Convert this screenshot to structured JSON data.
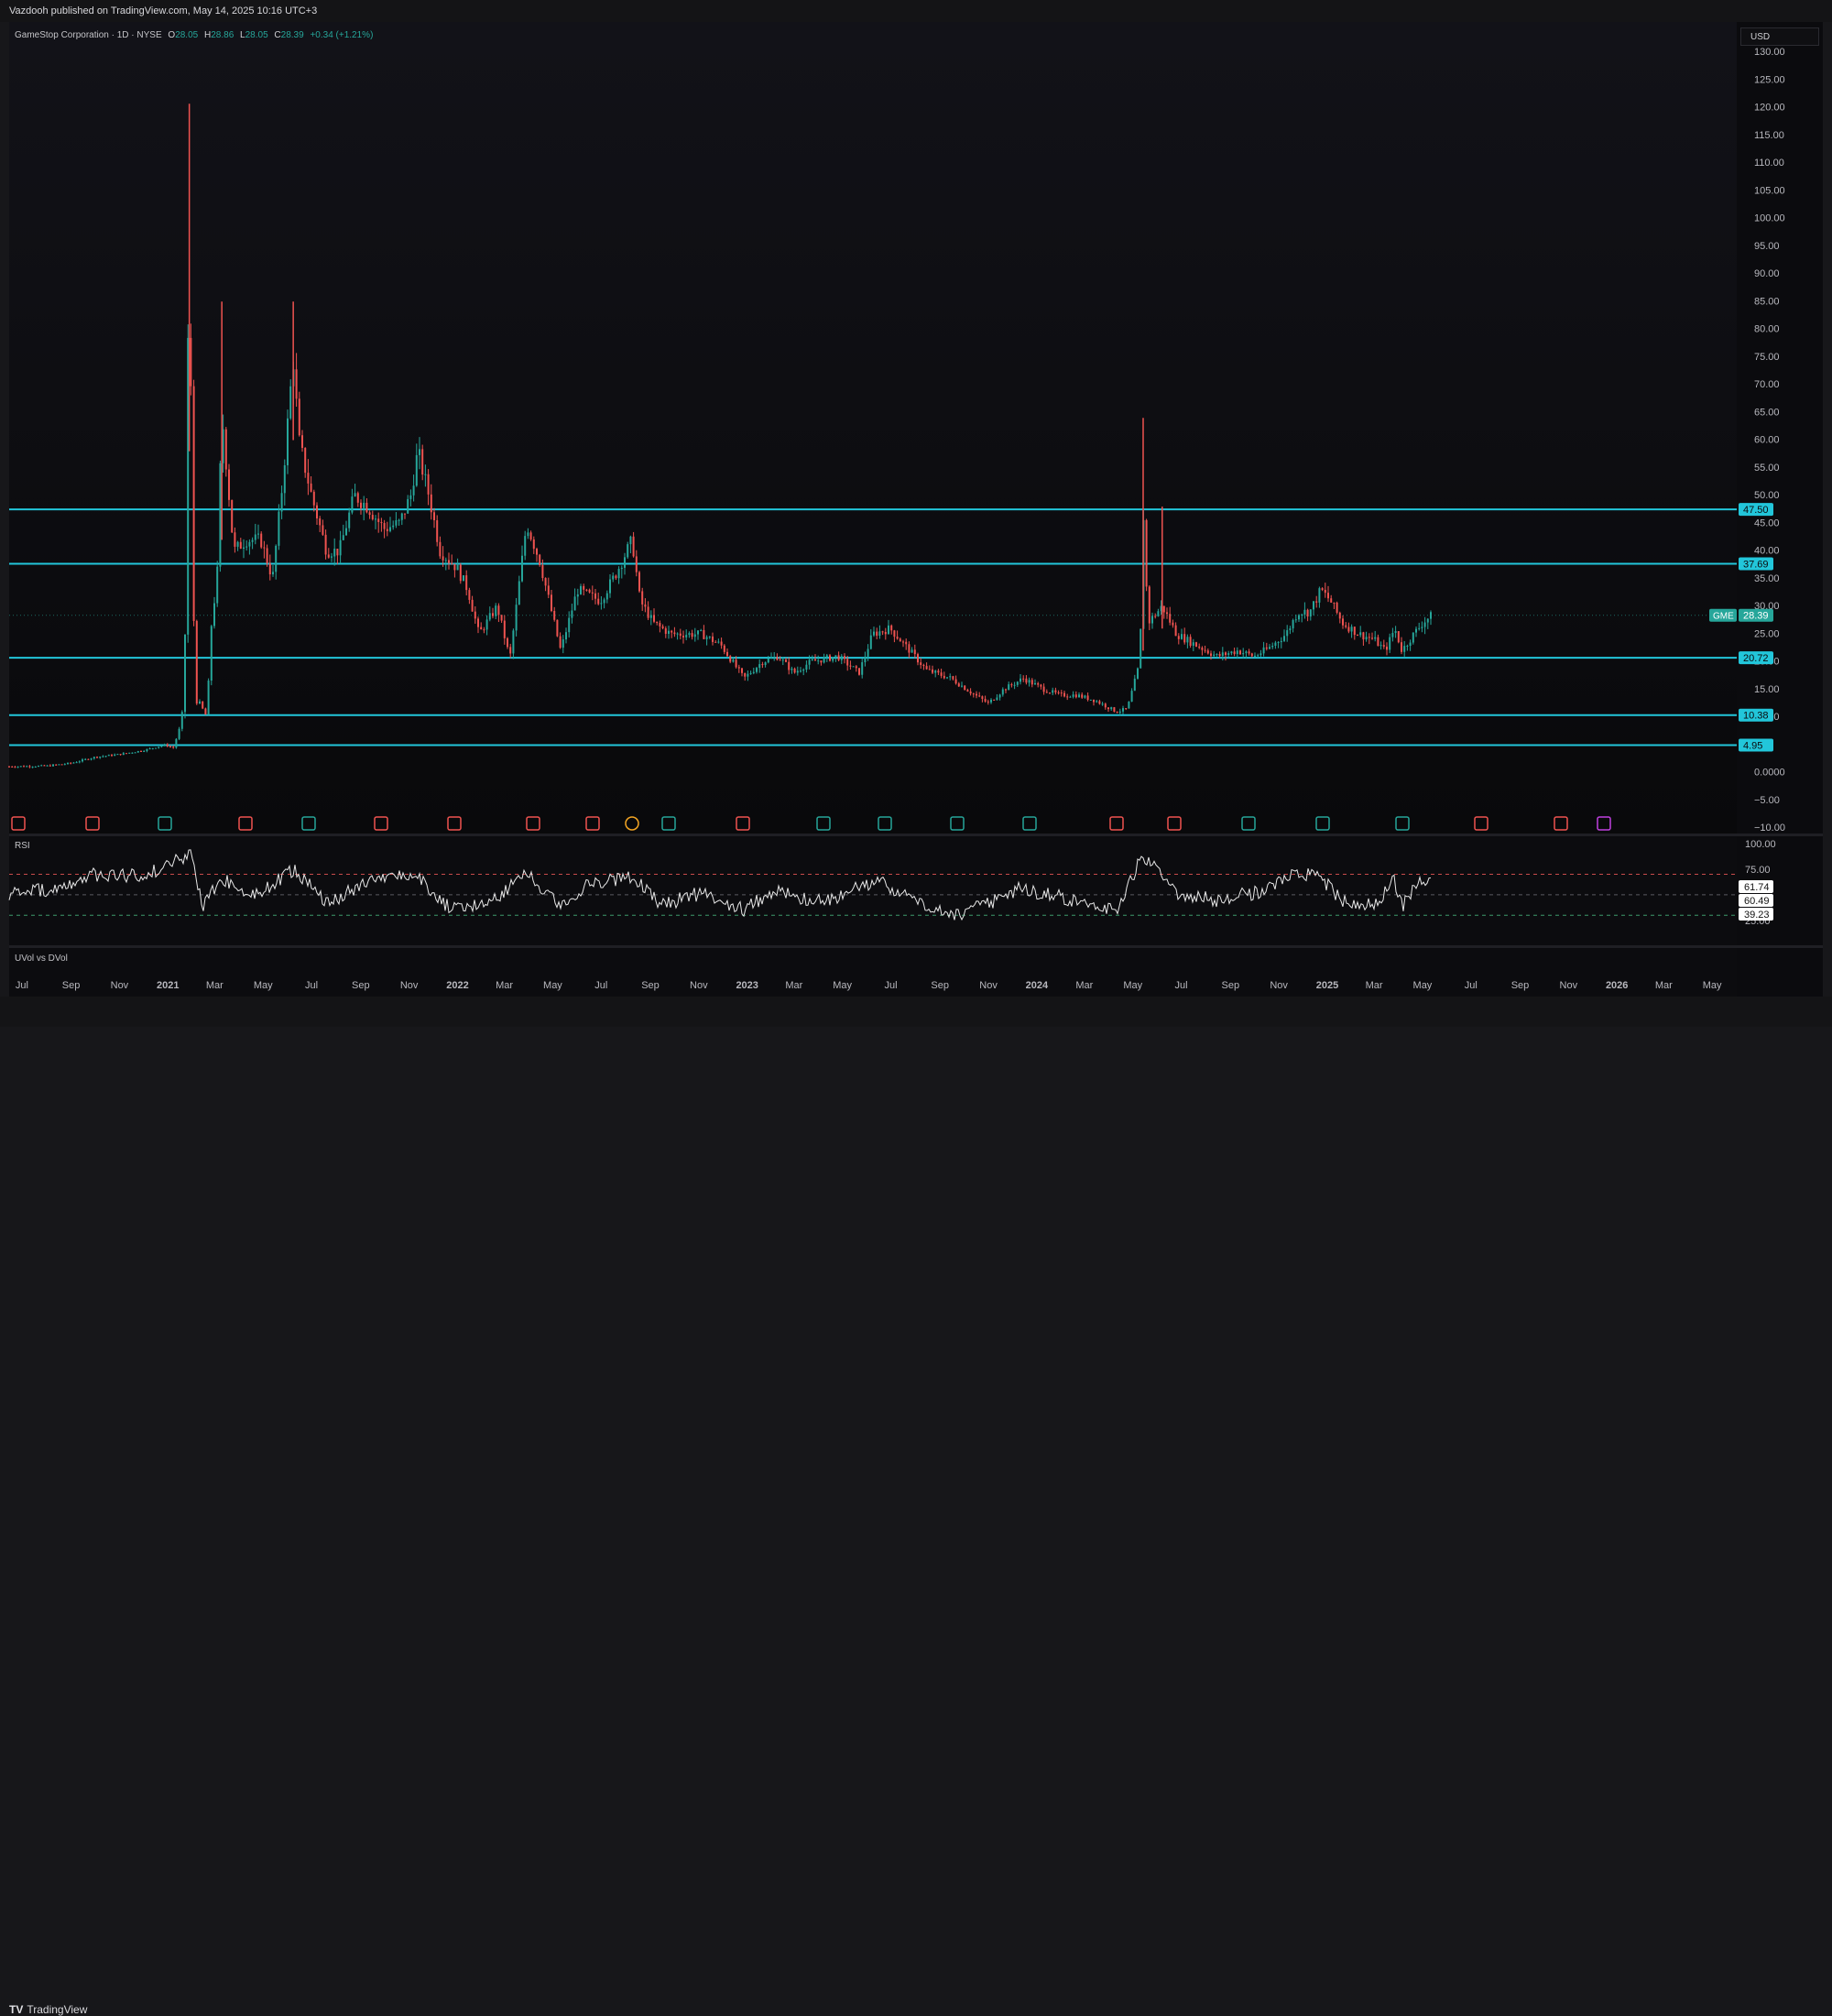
{
  "header": {
    "published": "Vazdooh published on TradingView.com, May 14, 2025 10:16 UTC+3"
  },
  "legend": {
    "symbol": "GameStop Corporation · 1D · NYSE",
    "o_label": "O",
    "o": "28.05",
    "h_label": "H",
    "h": "28.86",
    "l_label": "L",
    "l": "28.05",
    "c_label": "C",
    "c": "28.39",
    "change": "+0.34 (+1.21%)"
  },
  "currency": "USD",
  "rsi_label": "RSI",
  "uvol_label": "UVol vs DVol",
  "footer": {
    "brand": "TradingView"
  },
  "colors": {
    "up": "#26a69a",
    "down": "#ef5350",
    "level": "#22c6da",
    "rsi_line": "#e8e8e8"
  },
  "chart_data": [
    {
      "type": "candlestick",
      "symbol": "GME",
      "ylim": [
        -10,
        130
      ],
      "y_ticks": [
        "130.00",
        "125.00",
        "120.00",
        "115.00",
        "110.00",
        "105.00",
        "100.00",
        "95.00",
        "90.00",
        "85.00",
        "80.00",
        "75.00",
        "70.00",
        "65.00",
        "60.00",
        "55.00",
        "50.00",
        "45.00",
        "40.00",
        "35.00",
        "30.00",
        "25.00",
        "20.00",
        "15.00",
        "10.00",
        "5.00",
        "0.0000",
        "−5.00",
        "−10.00"
      ],
      "x_ticks": [
        "Jul",
        "Sep",
        "Nov",
        "2021",
        "Mar",
        "May",
        "Jul",
        "Sep",
        "Nov",
        "2022",
        "Mar",
        "May",
        "Jul",
        "Sep",
        "Nov",
        "2023",
        "Mar",
        "May",
        "Jul",
        "Sep",
        "Nov",
        "2024",
        "Mar",
        "May",
        "Jul",
        "Sep",
        "Nov",
        "2025",
        "Mar",
        "May",
        "Jul",
        "Sep",
        "Nov",
        "2026",
        "Mar",
        "May"
      ],
      "last_price": 28.39,
      "last_price_label": "28.39",
      "last_price_symbol": "GME",
      "horizontal_levels": [
        {
          "value": 47.5,
          "label": "47.50"
        },
        {
          "value": 37.69,
          "label": "37.69"
        },
        {
          "value": 20.72,
          "label": "20.72"
        },
        {
          "value": 10.38,
          "label": "10.38"
        },
        {
          "value": 4.95,
          "label": "4.95"
        }
      ],
      "series": [
        {
          "values": [
            [
              "2020-06-15",
              1.1
            ],
            [
              "2020-08-01",
              1.2
            ],
            [
              "2020-09-01",
              1.7
            ],
            [
              "2020-10-01",
              2.8
            ],
            [
              "2020-11-01",
              3.3
            ],
            [
              "2020-12-01",
              4.0
            ],
            [
              "2020-12-28",
              5.0
            ],
            [
              "2021-01-08",
              4.5
            ],
            [
              "2021-01-18",
              9.0
            ],
            [
              "2021-01-22",
              16.0
            ],
            [
              "2021-01-27",
              88.0
            ],
            [
              "2021-01-28",
              120.7
            ],
            [
              "2021-01-29",
              80.0
            ],
            [
              "2021-02-04",
              13.0
            ],
            [
              "2021-02-10",
              12.5
            ],
            [
              "2021-02-19",
              10.0
            ],
            [
              "2021-02-25",
              27.0
            ],
            [
              "2021-03-04",
              35.0
            ],
            [
              "2021-03-10",
              65.0
            ],
            [
              "2021-03-16",
              55.0
            ],
            [
              "2021-03-25",
              40.0
            ],
            [
              "2021-04-10",
              42.0
            ],
            [
              "2021-04-28",
              42.0
            ],
            [
              "2021-05-13",
              35.0
            ],
            [
              "2021-05-26",
              53.0
            ],
            [
              "2021-06-08",
              75.0
            ],
            [
              "2021-06-15",
              60.0
            ],
            [
              "2021-07-01",
              50.0
            ],
            [
              "2021-07-20",
              40.0
            ],
            [
              "2021-08-05",
              40.0
            ],
            [
              "2021-08-24",
              50.0
            ],
            [
              "2021-09-10",
              48.0
            ],
            [
              "2021-09-30",
              44.0
            ],
            [
              "2021-10-20",
              45.0
            ],
            [
              "2021-11-03",
              50.0
            ],
            [
              "2021-11-12",
              58.0
            ],
            [
              "2021-11-26",
              50.0
            ],
            [
              "2021-12-10",
              40.0
            ],
            [
              "2021-12-31",
              37.0
            ],
            [
              "2022-01-14",
              33.0
            ],
            [
              "2022-01-28",
              25.0
            ],
            [
              "2022-02-20",
              30.0
            ],
            [
              "2022-03-08",
              20.5
            ],
            [
              "2022-03-29",
              45.0
            ],
            [
              "2022-04-15",
              38.0
            ],
            [
              "2022-05-11",
              22.0
            ],
            [
              "2022-06-01",
              33.0
            ],
            [
              "2022-06-30",
              31.0
            ],
            [
              "2022-07-20",
              36.0
            ],
            [
              "2022-08-09",
              42.0
            ],
            [
              "2022-08-19",
              31.0
            ],
            [
              "2022-09-05",
              27.0
            ],
            [
              "2022-09-27",
              25.0
            ],
            [
              "2022-10-20",
              25.0
            ],
            [
              "2022-11-05",
              25.0
            ],
            [
              "2022-11-29",
              23.0
            ],
            [
              "2022-12-28",
              17.0
            ],
            [
              "2023-01-20",
              20.0
            ],
            [
              "2023-02-09",
              21.0
            ],
            [
              "2023-03-01",
              18.0
            ],
            [
              "2023-03-22",
              20.0
            ],
            [
              "2023-04-25",
              21.0
            ],
            [
              "2023-05-22",
              18.0
            ],
            [
              "2023-06-08",
              25.0
            ],
            [
              "2023-06-30",
              26.0
            ],
            [
              "2023-07-25",
              22.0
            ],
            [
              "2023-08-15",
              18.5
            ],
            [
              "2023-09-15",
              17.0
            ],
            [
              "2023-10-15",
              14.0
            ],
            [
              "2023-11-01",
              12.5
            ],
            [
              "2023-11-20",
              15.0
            ],
            [
              "2023-12-15",
              17.0
            ],
            [
              "2024-01-10",
              15.0
            ],
            [
              "2024-01-30",
              14.0
            ],
            [
              "2024-02-20",
              14.0
            ],
            [
              "2024-03-15",
              13.0
            ],
            [
              "2024-04-10",
              11.0
            ],
            [
              "2024-04-24",
              11.5
            ],
            [
              "2024-05-10",
              20.0
            ],
            [
              "2024-05-14",
              48.0
            ],
            [
              "2024-05-20",
              27.0
            ],
            [
              "2024-06-07",
              30.0
            ],
            [
              "2024-06-25",
              25.0
            ],
            [
              "2024-07-20",
              23.0
            ],
            [
              "2024-08-15",
              21.0
            ],
            [
              "2024-09-10",
              22.0
            ],
            [
              "2024-10-01",
              21.0
            ],
            [
              "2024-10-20",
              22.5
            ],
            [
              "2024-11-10",
              25.0
            ],
            [
              "2024-11-25",
              29.0
            ],
            [
              "2024-12-10",
              29.0
            ],
            [
              "2024-12-24",
              33.0
            ],
            [
              "2025-01-05",
              31.0
            ],
            [
              "2025-01-20",
              27.0
            ],
            [
              "2025-02-10",
              25.0
            ],
            [
              "2025-03-01",
              24.0
            ],
            [
              "2025-03-15",
              22.0
            ],
            [
              "2025-03-27",
              26.0
            ],
            [
              "2025-04-05",
              22.0
            ],
            [
              "2025-04-20",
              25.0
            ],
            [
              "2025-05-01",
              27.0
            ],
            [
              "2025-05-13",
              28.39
            ]
          ]
        }
      ]
    },
    {
      "type": "line",
      "title": "RSI",
      "ylim": [
        15,
        100
      ],
      "y_ticks": [
        "100.00",
        "75.00",
        "25.00"
      ],
      "reference_lines": [
        70,
        50,
        30
      ],
      "readouts": [
        "61.74",
        "60.49",
        "39.23"
      ],
      "series": [
        {
          "values": [
            [
              "2020-06-15",
              50
            ],
            [
              "2020-09-01",
              58
            ],
            [
              "2020-10-01",
              70
            ],
            [
              "2020-12-01",
              68
            ],
            [
              "2021-01-10",
              82
            ],
            [
              "2021-01-29",
              92
            ],
            [
              "2021-02-15",
              38
            ],
            [
              "2021-03-10",
              67
            ],
            [
              "2021-04-20",
              48
            ],
            [
              "2021-06-08",
              75
            ],
            [
              "2021-07-20",
              42
            ],
            [
              "2021-09-10",
              62
            ],
            [
              "2021-11-10",
              70
            ],
            [
              "2021-12-20",
              38
            ],
            [
              "2022-02-10",
              42
            ],
            [
              "2022-03-29",
              72
            ],
            [
              "2022-05-11",
              38
            ],
            [
              "2022-06-15",
              60
            ],
            [
              "2022-08-09",
              68
            ],
            [
              "2022-09-15",
              40
            ],
            [
              "2022-11-05",
              52
            ],
            [
              "2022-12-28",
              36
            ],
            [
              "2023-02-10",
              55
            ],
            [
              "2023-03-25",
              42
            ],
            [
              "2023-05-01",
              50
            ],
            [
              "2023-06-15",
              64
            ],
            [
              "2023-08-20",
              36
            ],
            [
              "2023-09-25",
              30
            ],
            [
              "2023-11-20",
              48
            ],
            [
              "2023-12-10",
              56
            ],
            [
              "2024-02-10",
              46
            ],
            [
              "2024-04-10",
              35
            ],
            [
              "2024-05-14",
              89
            ],
            [
              "2024-06-25",
              52
            ],
            [
              "2024-08-15",
              45
            ],
            [
              "2024-10-15",
              54
            ],
            [
              "2024-11-25",
              72
            ],
            [
              "2024-12-24",
              66
            ],
            [
              "2025-01-20",
              44
            ],
            [
              "2025-03-01",
              40
            ],
            [
              "2025-03-27",
              64
            ],
            [
              "2025-04-05",
              38
            ],
            [
              "2025-04-25",
              62
            ],
            [
              "2025-05-13",
              61.74
            ]
          ]
        }
      ]
    }
  ]
}
